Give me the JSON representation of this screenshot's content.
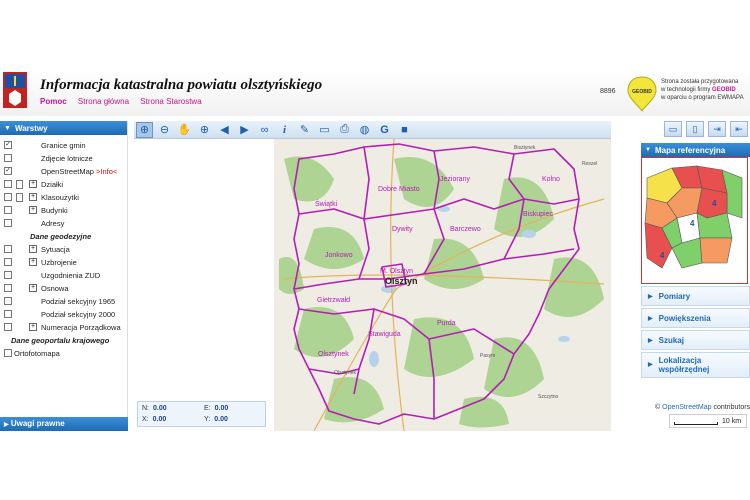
{
  "header": {
    "title": "Informacja katastralna powiatu olsztyńskiego",
    "links": [
      "Pomoc",
      "Strona główna",
      "Strona Starostwa"
    ],
    "counter": "8896",
    "geobid_lines": [
      "Strona została przygotowana",
      "w technologii firmy",
      "GEOBID",
      "w oparciu o program EWMAPA"
    ],
    "geobid_logo_text": "GEOBID"
  },
  "left_panel": {
    "title": "Warstwy",
    "bottom_title": "Uwagi prawne",
    "layers": [
      {
        "label": "Granice gmin",
        "checked": true
      },
      {
        "label": "Zdjęcie lotnicze",
        "checked": false
      },
      {
        "label": "OpenStreetMap",
        "info": ">Info<",
        "checked": true
      },
      {
        "label": "Działki",
        "checked": false
      },
      {
        "label": "Klasoużytki",
        "checked": false
      },
      {
        "label": "Budynki",
        "checked": false
      },
      {
        "label": "Adresy",
        "checked": false
      }
    ],
    "group_geodezyjne": "Dane geodezyjne",
    "geod_layers": [
      {
        "label": "Sytuacja"
      },
      {
        "label": "Uzbrojenie"
      },
      {
        "label": "Uzgodnienia ZUD"
      },
      {
        "label": "Osnowa"
      },
      {
        "label": "Podział sekcyjny 1965"
      },
      {
        "label": "Podział sekcyjny 2000"
      },
      {
        "label": "Numeracja Porządkowa"
      }
    ],
    "group_krajowy": "Dane geoportalu krajowego",
    "krajowy_layers": [
      {
        "label": "Ortofotomapa"
      }
    ]
  },
  "toolbar": {
    "tools": [
      "zoom-extent-icon",
      "zoom-out-icon",
      "pan-hand-icon",
      "zoom-in-icon",
      "back-arrow-icon",
      "forward-arrow-icon",
      "link-icon",
      "info-icon",
      "brush-icon",
      "measure-icon",
      "print-icon",
      "globe-icon",
      "google-icon",
      "camera-icon"
    ]
  },
  "map": {
    "labels": {
      "dobre_miasto": "Dobre Miasto",
      "jeziorany": "Jeziorany",
      "kolno": "Kolno",
      "swiatki": "Świątki",
      "dywity": "Dywity",
      "barczewo": "Barczewo",
      "biskupiec": "Biskupiec",
      "jonkowo": "Jonkowo",
      "olsztyn_small": "M. Olsztyn",
      "olsztyn": "Olsztyn",
      "gietrzwald": "Gietrzwałd",
      "purda": "Purda",
      "stawiguda": "Stawiguda",
      "olsztynek": "Olsztynek",
      "bisztynek": "Bisztynek",
      "reszel": "Reszel",
      "pasym": "Pasym",
      "szczytno": "Szczytno",
      "olsztynek_town": "Olsztynek"
    },
    "coords": {
      "n_label": "N:",
      "n": "0.00",
      "e_label": "E:",
      "e": "0.00",
      "x_label": "X:",
      "x": "0.00",
      "y_label": "Y:",
      "y": "0.00"
    }
  },
  "right_panel": {
    "ref_title": "Mapa referencyjna",
    "items": [
      "Pomiary",
      "Powiększenia",
      "Szukaj",
      "Lokalizacja współrzędnej"
    ],
    "ref_numbers": [
      "4",
      "4",
      "4"
    ]
  },
  "attribution": {
    "prefix": "©",
    "osm": "OpenStreetMap",
    "suffix": "contributors"
  },
  "scale": "10 km",
  "colors": {
    "accent": "#1d6bb4",
    "boundary": "#b41eb4",
    "link": "#c0168c"
  }
}
